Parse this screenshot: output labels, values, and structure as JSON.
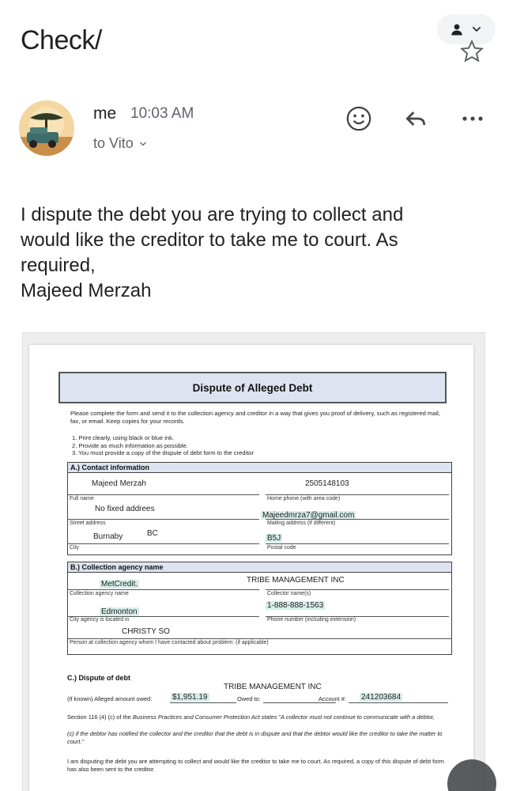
{
  "header": {
    "subject": "Check/"
  },
  "message": {
    "sender": "me",
    "time": "10:03 AM",
    "recipient_line": "to Vito",
    "body_lines": [
      "I dispute the debt you are trying to collect and",
      "would like the creditor to take me to court. As",
      "required,",
      "Majeed Merzah"
    ]
  },
  "icons": {
    "account": "person-icon",
    "star": "star-outline-icon",
    "emoji": "emoji-icon",
    "reply": "reply-icon",
    "more": "more-horizontal-icon"
  },
  "attachment": {
    "title": "Dispute of Alleged Debt",
    "intro": "Please complete the form and send it to the collection agency and creditor in a way that gives you proof of delivery, such as registered mail, fax, or email. Keep copies for your records.",
    "steps": [
      "1.  Print clearly, using black or blue ink.",
      "2.  Provide as much information as possible.",
      "3.  You must provide a copy of the dispute of debt form to the creditor"
    ],
    "section_a": {
      "heading": "A.) Contact information",
      "full_name": "Majeed Merzah",
      "full_name_label": "Full name",
      "home_phone": "2505148103",
      "home_phone_label": "Home phone (with area code)",
      "street": "No fixed addrees",
      "street_label": "Street address",
      "mailing": "Majeedmrza7@gmail.com",
      "mailing_label": "Mailing address (if different)",
      "city": "Burnaby",
      "province": "BC",
      "city_label": "City",
      "postal": "B5J",
      "postal_label": "Postal code"
    },
    "section_b": {
      "heading": "B.) Collection agency name",
      "agency": "MetCredit.",
      "agency_label": "Collection agency name",
      "collector": "TRIBE MANAGEMENT INC",
      "collector_label": "Collector name(s)",
      "phone": "1-888-888-1563",
      "phone_label": "Phone number (including extension)",
      "city": "Edmonton",
      "city_label": "City agency is located in",
      "contact": "CHRISTY SO",
      "contact_label": "Person at collection agency whom I have contacted about problem: (if applicable)"
    },
    "section_c": {
      "heading": "C.) Dispute of debt",
      "owed_to_value": "TRIBE MANAGEMENT INC",
      "amount_prefix": "(If known) Alleged amount owed:",
      "amount": "$1,951.19",
      "owed_to_label": "Owed to:",
      "account_label": "Account #:",
      "account": "241203684",
      "statute_1": "Section 116 (4) (c) of the",
      "statute_act": "Business Practices and Consumer Protection Act",
      "statute_2": "states \"A collector must not continue to communicate with a debtor,",
      "statute_3": "(c) if the debtor has notified the collector and the creditor that the debt is in dispute and that the debtor would like the creditor to take the matter to court.\"",
      "closing": "I am disputing the debt you are attempting to collect and would like the creditor to take me to court. As required, a copy of this dispute of debt form has also been sent to the creditor."
    }
  }
}
